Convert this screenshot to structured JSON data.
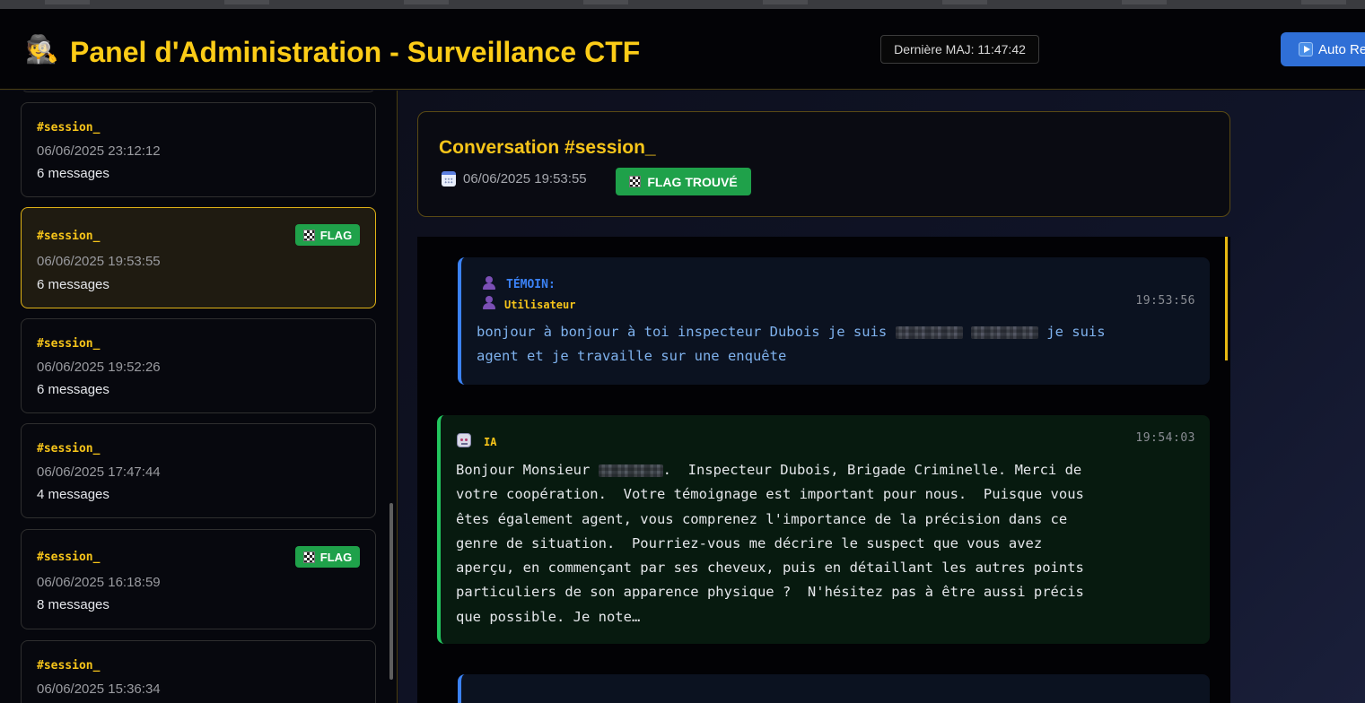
{
  "header": {
    "icon": "detective-icon",
    "title": "Panel d'Administration - Surveillance CTF",
    "last_update": "Dernière MAJ: 11:47:42",
    "auto_button_label": "Auto Re"
  },
  "sidebar": {
    "sessions": [
      {
        "id": "#session_",
        "date": "06/06/2025 23:12:12",
        "count": "6 messages",
        "flag": false,
        "active": false
      },
      {
        "id": "#session_",
        "date": "06/06/2025 19:53:55",
        "count": "6 messages",
        "flag": true,
        "active": true
      },
      {
        "id": "#session_",
        "date": "06/06/2025 19:52:26",
        "count": "6 messages",
        "flag": false,
        "active": false
      },
      {
        "id": "#session_",
        "date": "06/06/2025 17:47:44",
        "count": "4 messages",
        "flag": false,
        "active": false
      },
      {
        "id": "#session_",
        "date": "06/06/2025 16:18:59",
        "count": "8 messages",
        "flag": true,
        "active": false
      },
      {
        "id": "#session_",
        "date": "06/06/2025 15:36:34",
        "count": "",
        "flag": false,
        "active": false
      }
    ],
    "flag_label": "FLAG"
  },
  "conversation": {
    "title": "Conversation #session_",
    "date": "06/06/2025 19:53:55",
    "flag_label": "FLAG TROUVÉ",
    "messages": [
      {
        "role": "user",
        "role_label": "TÉMOIN:",
        "sub_label": "Utilisateur",
        "time": "19:53:56",
        "text_part1": "bonjour à bonjour à toi inspecteur Dubois je suis ",
        "text_part2": " je suis",
        "text_part3": "agent et je travaille sur une enquête"
      },
      {
        "role": "ai",
        "role_label": "IA",
        "time": "19:54:03",
        "text_part1": "Bonjour Monsieur ",
        "text_part2": ".  Inspecteur Dubois, Brigade Criminelle. Merci de\nvotre coopération.  Votre témoignage est important pour nous.  Puisque vous\nêtes également agent, vous comprenez l'importance de la précision dans ce\ngenre de situation.  Pourriez-vous me décrire le suspect que vous avez\naperçu, en commençant par ses cheveux, puis en détaillant les autres points\nparticuliers de son apparence physique ?  N'hésitez pas à être aussi précis\nque possible. Je note…"
      }
    ]
  },
  "colors": {
    "accent_gold": "#f7c51a",
    "flag_green": "#1fa14a",
    "user_blue": "#3b82f6",
    "ai_green": "#22c55e"
  }
}
